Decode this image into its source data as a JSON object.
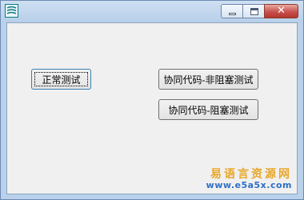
{
  "window": {
    "icon": "app-icon",
    "caption_buttons": {
      "minimize_icon": "minimize-icon",
      "maximize_icon": "maximize-icon",
      "close_icon": "close-icon",
      "close_glyph": "✕"
    }
  },
  "buttons": {
    "normal_test": "正常测试",
    "coroutine_nonblocking_test": "协同代码-非阻塞测试",
    "coroutine_blocking_test": "协同代码-阻塞测试"
  },
  "watermark": {
    "title": "易语言资源网",
    "url": "www.e5a5x.com"
  },
  "colors": {
    "title_bar": "#b9d1ea",
    "client_background": "#f0f0f0",
    "close_button": "#c75050",
    "watermark_title": "#e8a72a",
    "watermark_url": "#2f6fc7"
  }
}
